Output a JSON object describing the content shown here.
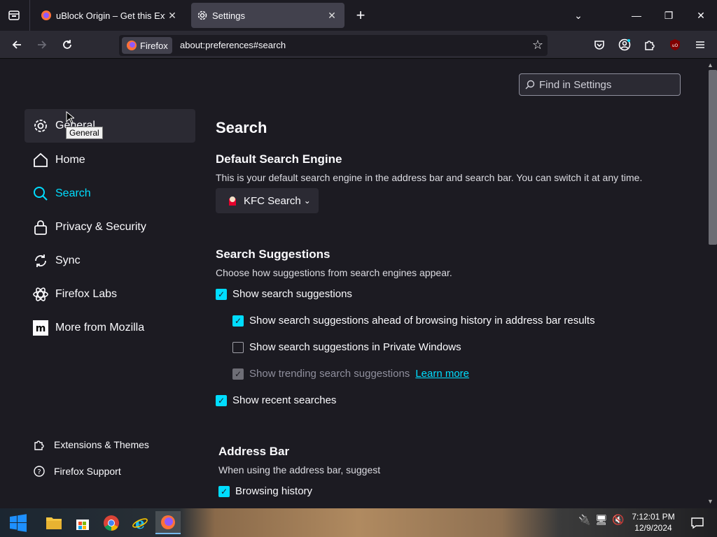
{
  "tabs": [
    {
      "title": "uBlock Origin – Get this Extensi",
      "close": "✕"
    },
    {
      "title": "Settings",
      "close": "✕"
    }
  ],
  "window_controls": {
    "minimize": "—",
    "restore": "❐",
    "close": "✕",
    "list_all": "⌄"
  },
  "urlbar": {
    "identity": "Firefox",
    "url": "about:preferences#search"
  },
  "find": {
    "placeholder": "Find in Settings"
  },
  "sidebar": {
    "items": [
      {
        "label": "General",
        "icon": "gear-icon"
      },
      {
        "label": "Home",
        "icon": "home-icon"
      },
      {
        "label": "Search",
        "icon": "search-icon"
      },
      {
        "label": "Privacy & Security",
        "icon": "lock-icon"
      },
      {
        "label": "Sync",
        "icon": "sync-icon"
      },
      {
        "label": "Firefox Labs",
        "icon": "labs-icon"
      },
      {
        "label": "More from Mozilla",
        "icon": "mozilla-icon"
      }
    ],
    "bottom": [
      {
        "label": "Extensions & Themes",
        "icon": "puzzle-icon"
      },
      {
        "label": "Firefox Support",
        "icon": "help-icon"
      }
    ]
  },
  "tooltip": "General",
  "main": {
    "title": "Search",
    "default_engine": {
      "heading": "Default Search Engine",
      "desc": "This is your default search engine in the address bar and search bar. You can switch it at any time.",
      "engine": "KFC Search"
    },
    "suggestions": {
      "heading": "Search Suggestions",
      "desc": "Choose how suggestions from search engines appear.",
      "show": "Show search suggestions",
      "ahead": "Show search suggestions ahead of browsing history in address bar results",
      "private": "Show search suggestions in Private Windows",
      "trending": "Show trending search suggestions",
      "learn_more": "Learn more",
      "recent": "Show recent searches"
    },
    "address_bar": {
      "heading": "Address Bar",
      "desc": "When using the address bar, suggest",
      "history": "Browsing history"
    }
  },
  "clock": {
    "time": "7:12:01 PM",
    "date": "12/9/2024"
  },
  "colors": {
    "accent": "#00ddff",
    "background": "#1c1b22",
    "toolbar": "#2b2a33"
  }
}
